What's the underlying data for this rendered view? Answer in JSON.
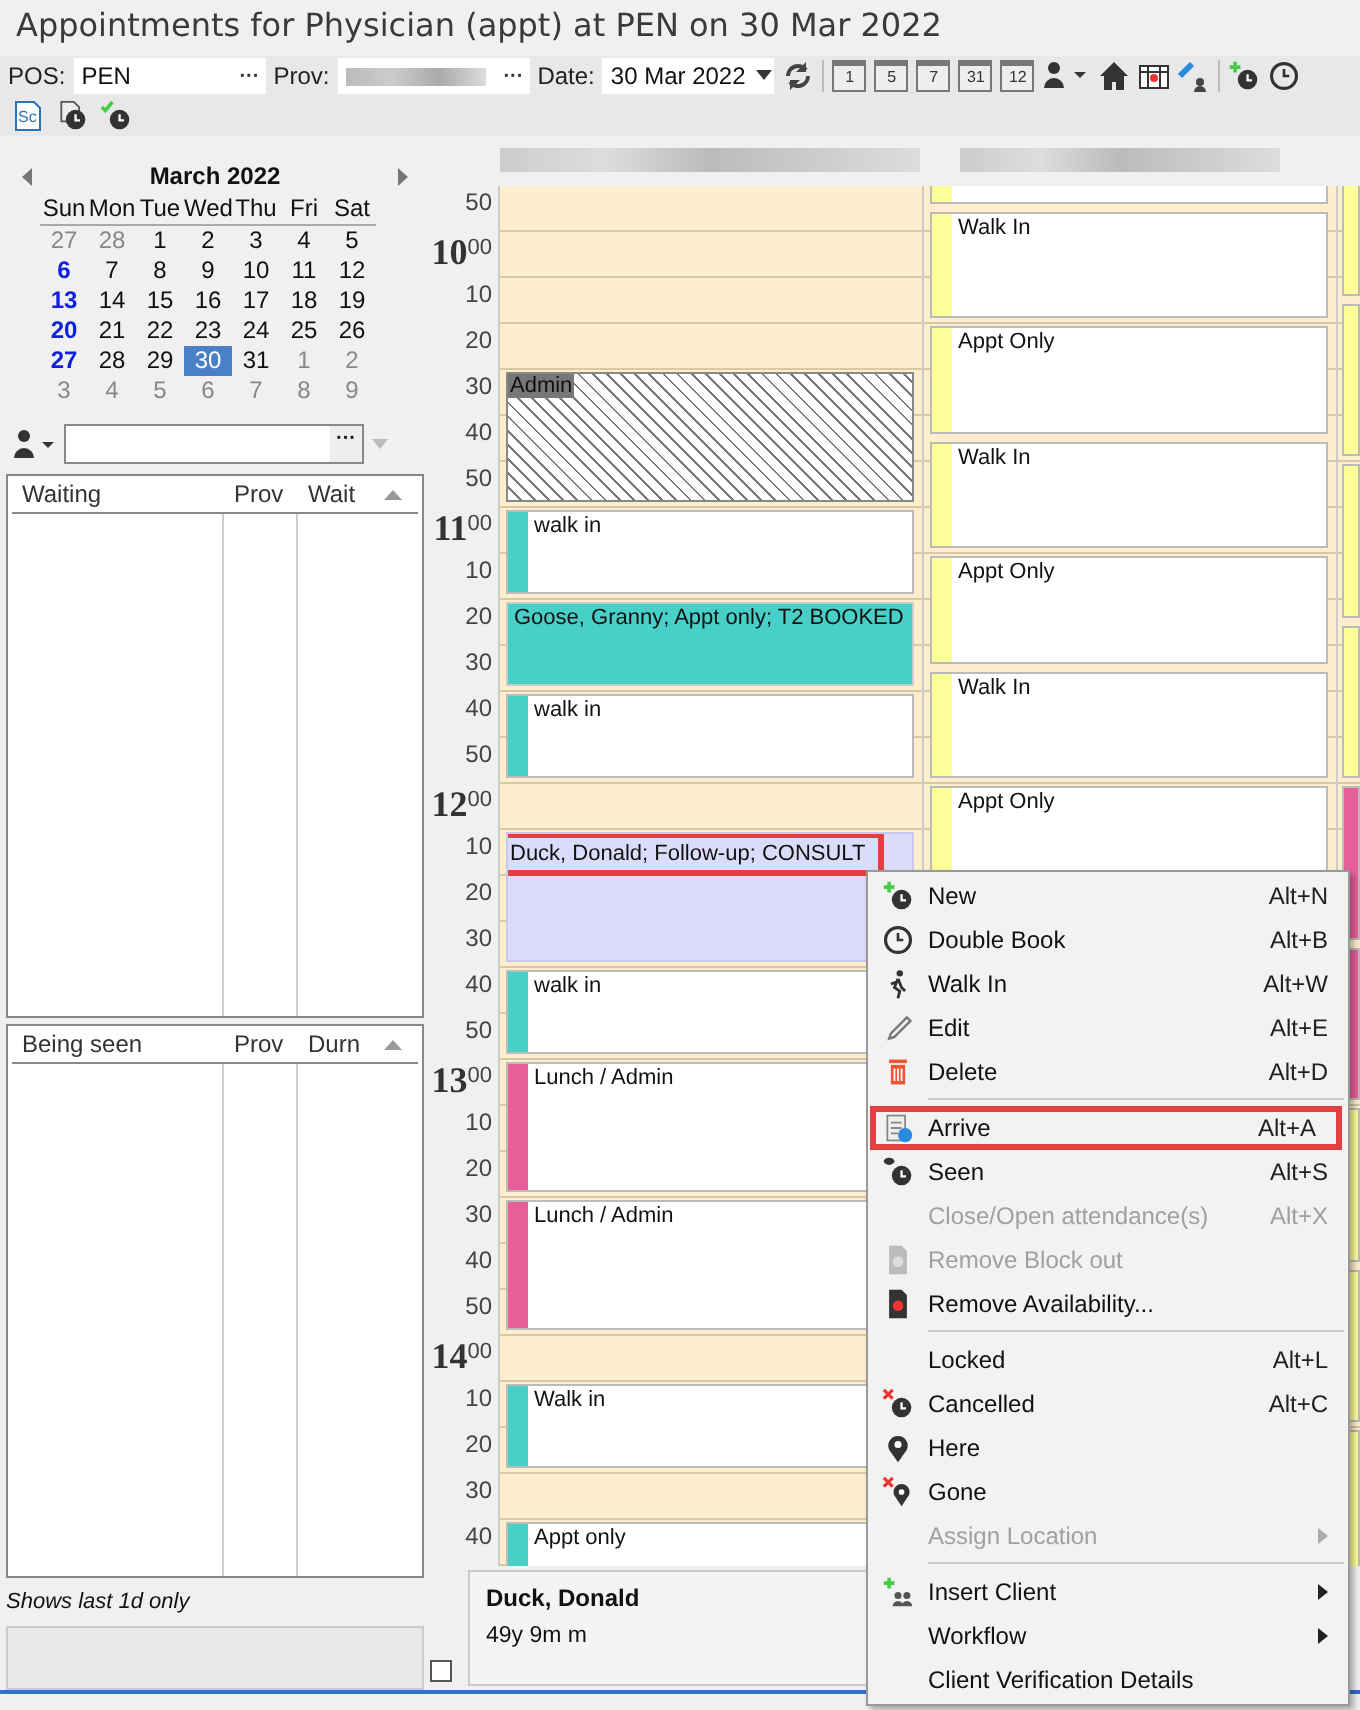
{
  "window": {
    "title": "Appointments for Physician (appt) at PEN on 30 Mar 2022"
  },
  "toolbar": {
    "pos": {
      "label": "POS:",
      "value": "PEN",
      "button": "···"
    },
    "prov": {
      "label": "Prov:",
      "button": "···"
    },
    "date": {
      "label": "Date:",
      "value": "30 Mar 2022"
    },
    "calendar_buttons": [
      "1",
      "5",
      "7",
      "31",
      "12"
    ],
    "sc_label": "Sc"
  },
  "calendar": {
    "month": "March 2022",
    "weekdays": [
      "Sun",
      "Mon",
      "Tue",
      "Wed",
      "Thu",
      "Fri",
      "Sat"
    ],
    "weeks": [
      [
        {
          "day": "27",
          "kind": "other",
          "selected": false
        },
        {
          "day": "28",
          "kind": "other",
          "selected": false
        },
        {
          "day": "1",
          "kind": "normal",
          "selected": false
        },
        {
          "day": "2",
          "kind": "normal",
          "selected": false
        },
        {
          "day": "3",
          "kind": "normal",
          "selected": false
        },
        {
          "day": "4",
          "kind": "normal",
          "selected": false
        },
        {
          "day": "5",
          "kind": "normal",
          "selected": false
        }
      ],
      [
        {
          "day": "6",
          "kind": "sunday",
          "selected": false
        },
        {
          "day": "7",
          "kind": "normal",
          "selected": false
        },
        {
          "day": "8",
          "kind": "normal",
          "selected": false
        },
        {
          "day": "9",
          "kind": "normal",
          "selected": false
        },
        {
          "day": "10",
          "kind": "normal",
          "selected": false
        },
        {
          "day": "11",
          "kind": "normal",
          "selected": false
        },
        {
          "day": "12",
          "kind": "normal",
          "selected": false
        }
      ],
      [
        {
          "day": "13",
          "kind": "sunday",
          "selected": false
        },
        {
          "day": "14",
          "kind": "normal",
          "selected": false
        },
        {
          "day": "15",
          "kind": "normal",
          "selected": false
        },
        {
          "day": "16",
          "kind": "normal",
          "selected": false
        },
        {
          "day": "17",
          "kind": "normal",
          "selected": false
        },
        {
          "day": "18",
          "kind": "normal",
          "selected": false
        },
        {
          "day": "19",
          "kind": "normal",
          "selected": false
        }
      ],
      [
        {
          "day": "20",
          "kind": "sunday",
          "selected": false
        },
        {
          "day": "21",
          "kind": "normal",
          "selected": false
        },
        {
          "day": "22",
          "kind": "normal",
          "selected": false
        },
        {
          "day": "23",
          "kind": "normal",
          "selected": false
        },
        {
          "day": "24",
          "kind": "normal",
          "selected": false
        },
        {
          "day": "25",
          "kind": "normal",
          "selected": false
        },
        {
          "day": "26",
          "kind": "normal",
          "selected": false
        }
      ],
      [
        {
          "day": "27",
          "kind": "sunday",
          "selected": false
        },
        {
          "day": "28",
          "kind": "normal",
          "selected": false
        },
        {
          "day": "29",
          "kind": "normal",
          "selected": false
        },
        {
          "day": "30",
          "kind": "normal",
          "selected": true
        },
        {
          "day": "31",
          "kind": "normal",
          "selected": false
        },
        {
          "day": "1",
          "kind": "other",
          "selected": false
        },
        {
          "day": "2",
          "kind": "other",
          "selected": false
        }
      ],
      [
        {
          "day": "3",
          "kind": "other",
          "selected": false
        },
        {
          "day": "4",
          "kind": "other",
          "selected": false
        },
        {
          "day": "5",
          "kind": "other",
          "selected": false
        },
        {
          "day": "6",
          "kind": "other",
          "selected": false
        },
        {
          "day": "7",
          "kind": "other",
          "selected": false
        },
        {
          "day": "8",
          "kind": "other",
          "selected": false
        },
        {
          "day": "9",
          "kind": "other",
          "selected": false
        }
      ]
    ]
  },
  "client_filter": {
    "button": "···"
  },
  "waiting": {
    "columns": [
      "Waiting",
      "Prov",
      "Wait"
    ]
  },
  "being_seen": {
    "columns": [
      "Being seen",
      "Prov",
      "Durn"
    ]
  },
  "history_note": "Shows last 1d  only",
  "schedule": {
    "times": [
      {
        "minutes": "50"
      },
      {
        "hour": "10",
        "minutes": "00"
      },
      {
        "minutes": "10"
      },
      {
        "minutes": "20"
      },
      {
        "minutes": "30"
      },
      {
        "minutes": "40"
      },
      {
        "minutes": "50"
      },
      {
        "hour": "11",
        "minutes": "00"
      },
      {
        "minutes": "10"
      },
      {
        "minutes": "20"
      },
      {
        "minutes": "30"
      },
      {
        "minutes": "40"
      },
      {
        "minutes": "50"
      },
      {
        "hour": "12",
        "minutes": "00"
      },
      {
        "minutes": "10"
      },
      {
        "minutes": "20"
      },
      {
        "minutes": "30"
      },
      {
        "minutes": "40"
      },
      {
        "minutes": "50"
      },
      {
        "hour": "13",
        "minutes": "00"
      },
      {
        "minutes": "10"
      },
      {
        "minutes": "20"
      },
      {
        "minutes": "30"
      },
      {
        "minutes": "40"
      },
      {
        "minutes": "50"
      },
      {
        "hour": "14",
        "minutes": "00"
      },
      {
        "minutes": "10"
      },
      {
        "minutes": "20"
      },
      {
        "minutes": "30"
      },
      {
        "minutes": "40"
      }
    ],
    "columns": [
      {
        "appointments": [
          {
            "kind": "blockout",
            "label": "Admin",
            "highlighted": false
          },
          {
            "kind": "striped",
            "label": "walk in",
            "color": "#48d0c8",
            "highlighted": false
          },
          {
            "kind": "filled",
            "label": "Goose, Granny; Appt only; T2 BOOKED",
            "color": "#48d0c8",
            "highlighted": false
          },
          {
            "kind": "striped",
            "label": "walk in",
            "color": "#48d0c8",
            "highlighted": false
          },
          {
            "kind": "selected",
            "label": "Duck, Donald; Follow-up; CONSULT",
            "highlighted": true
          },
          {
            "kind": "striped",
            "label": "walk in",
            "color": "#48d0c8",
            "highlighted": false
          },
          {
            "kind": "striped",
            "label": "Lunch / Admin",
            "color": "#e8609a",
            "highlighted": false
          },
          {
            "kind": "striped",
            "label": "Lunch / Admin",
            "color": "#e8609a",
            "highlighted": false
          },
          {
            "kind": "striped",
            "label": "Walk in",
            "color": "#48d0c8",
            "highlighted": false
          },
          {
            "kind": "striped",
            "label": "Appt only",
            "color": "#48d0c8",
            "highlighted": false
          }
        ]
      },
      {
        "appointments": [
          {
            "kind": "striped",
            "color": "#ffff99"
          },
          {
            "kind": "striped",
            "label": "Walk In",
            "color": "#ffff99"
          },
          {
            "kind": "striped",
            "label": "Appt Only",
            "color": "#ffff99"
          },
          {
            "kind": "striped",
            "label": "Walk In",
            "color": "#ffff99"
          },
          {
            "kind": "striped",
            "label": "Appt Only",
            "color": "#ffff99"
          },
          {
            "kind": "striped",
            "label": "Walk In",
            "color": "#ffff99"
          },
          {
            "kind": "striped",
            "label": "Appt Only",
            "color": "#ffff99"
          }
        ]
      },
      {
        "appointments": [
          {
            "kind": "striped",
            "color": "#ffff99"
          },
          {
            "kind": "striped",
            "color": "#ffff99"
          },
          {
            "kind": "striped",
            "color": "#ffff99"
          },
          {
            "kind": "striped",
            "color": "#ffff99"
          },
          {
            "kind": "striped",
            "color": "#e8609a"
          },
          {
            "kind": "striped",
            "color": "#e8609a"
          },
          {
            "kind": "striped",
            "color": "#ffff99"
          },
          {
            "kind": "striped",
            "color": "#ffff99"
          },
          {
            "kind": "striped",
            "color": "#ffff99"
          }
        ]
      }
    ]
  },
  "client_panel": {
    "name": "Duck, Donald",
    "age": "49y 9m m"
  },
  "context_menu": {
    "items": [
      {
        "kind": "item",
        "label": "New",
        "shortcut": "Alt+N",
        "disabled": false,
        "highlighted": false
      },
      {
        "kind": "item",
        "label": "Double Book",
        "shortcut": "Alt+B",
        "disabled": false,
        "highlighted": false
      },
      {
        "kind": "item",
        "label": "Walk In",
        "shortcut": "Alt+W",
        "disabled": false,
        "highlighted": false
      },
      {
        "kind": "item",
        "label": "Edit",
        "shortcut": "Alt+E",
        "disabled": false,
        "highlighted": false
      },
      {
        "kind": "item",
        "label": "Delete",
        "shortcut": "Alt+D",
        "disabled": false,
        "highlighted": false
      },
      {
        "kind": "separator"
      },
      {
        "kind": "item",
        "label": "Arrive",
        "shortcut": "Alt+A",
        "disabled": false,
        "highlighted": true
      },
      {
        "kind": "item",
        "label": "Seen",
        "shortcut": "Alt+S",
        "disabled": false,
        "highlighted": false
      },
      {
        "kind": "item",
        "label": "Close/Open attendance(s)",
        "shortcut": "Alt+X",
        "disabled": true,
        "highlighted": false
      },
      {
        "kind": "item",
        "label": "Remove Block out",
        "disabled": true,
        "highlighted": false
      },
      {
        "kind": "item",
        "label": "Remove Availability...",
        "disabled": false,
        "highlighted": false
      },
      {
        "kind": "separator"
      },
      {
        "kind": "item",
        "label": "Locked",
        "shortcut": "Alt+L",
        "disabled": false,
        "highlighted": false
      },
      {
        "kind": "item",
        "label": "Cancelled",
        "shortcut": "Alt+C",
        "disabled": false,
        "highlighted": false
      },
      {
        "kind": "item",
        "label": "Here",
        "disabled": false,
        "highlighted": false
      },
      {
        "kind": "item",
        "label": "Gone",
        "disabled": false,
        "highlighted": false
      },
      {
        "kind": "item",
        "label": "Assign Location",
        "disabled": true,
        "submenu": true,
        "highlighted": false
      },
      {
        "kind": "separator"
      },
      {
        "kind": "item",
        "label": "Insert Client",
        "disabled": false,
        "submenu": true,
        "highlighted": false
      },
      {
        "kind": "item",
        "label": "Workflow",
        "disabled": false,
        "submenu": true,
        "highlighted": false
      },
      {
        "kind": "item",
        "label": "Client Verification Details",
        "disabled": false,
        "highlighted": false
      }
    ]
  }
}
